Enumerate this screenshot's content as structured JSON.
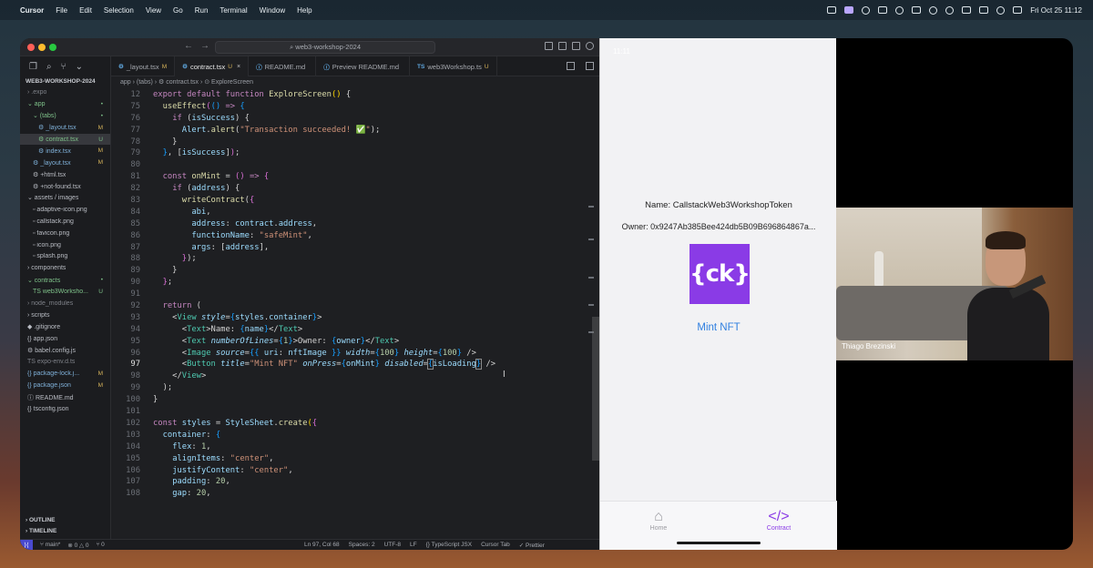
{
  "menubar": {
    "app": "Cursor",
    "items": [
      "File",
      "Edit",
      "Selection",
      "View",
      "Go",
      "Run",
      "Terminal",
      "Window",
      "Help"
    ],
    "clock": "Fri Oct 25  11:12"
  },
  "editor": {
    "search": "web3-workshop-2024",
    "explorer_title": "WEB3-WORKSHOP-2024",
    "tree": [
      {
        "name": "› .expo",
        "indent": 8,
        "status": "",
        "cls": "dim"
      },
      {
        "name": "⌄ app",
        "indent": 8,
        "status": "•",
        "cls": "green"
      },
      {
        "name": "⌄ (tabs)",
        "indent": 14,
        "status": "•",
        "cls": "green"
      },
      {
        "name": "⚙ _layout.tsx",
        "indent": 20,
        "status": "M",
        "cls": "mod"
      },
      {
        "name": "⚙ contract.tsx",
        "indent": 20,
        "status": "U",
        "cls": "green sel"
      },
      {
        "name": "⚙ index.tsx",
        "indent": 20,
        "status": "M",
        "cls": "mod"
      },
      {
        "name": "⚙ _layout.tsx",
        "indent": 14,
        "status": "M",
        "cls": "mod"
      },
      {
        "name": "⚙ +html.tsx",
        "indent": 14,
        "status": "",
        "cls": ""
      },
      {
        "name": "⚙ +not-found.tsx",
        "indent": 14,
        "status": "",
        "cls": ""
      },
      {
        "name": "⌄ assets / images",
        "indent": 8,
        "status": "",
        "cls": ""
      },
      {
        "name": "▫ adaptive-icon.png",
        "indent": 14,
        "status": "",
        "cls": ""
      },
      {
        "name": "▫ callstack.png",
        "indent": 14,
        "status": "",
        "cls": ""
      },
      {
        "name": "▫ favicon.png",
        "indent": 14,
        "status": "",
        "cls": ""
      },
      {
        "name": "▫ icon.png",
        "indent": 14,
        "status": "",
        "cls": ""
      },
      {
        "name": "▫ splash.png",
        "indent": 14,
        "status": "",
        "cls": ""
      },
      {
        "name": "› components",
        "indent": 8,
        "status": "",
        "cls": ""
      },
      {
        "name": "⌄ contracts",
        "indent": 8,
        "status": "•",
        "cls": "green"
      },
      {
        "name": "TS web3Worksho...",
        "indent": 14,
        "status": "U",
        "cls": "green"
      },
      {
        "name": "› node_modules",
        "indent": 8,
        "status": "",
        "cls": "dim"
      },
      {
        "name": "› scripts",
        "indent": 8,
        "status": "",
        "cls": ""
      },
      {
        "name": "◆ .gitignore",
        "indent": 8,
        "status": "",
        "cls": ""
      },
      {
        "name": "{} app.json",
        "indent": 8,
        "status": "",
        "cls": ""
      },
      {
        "name": "⚙ babel.config.js",
        "indent": 8,
        "status": "",
        "cls": ""
      },
      {
        "name": "TS expo-env.d.ts",
        "indent": 8,
        "status": "",
        "cls": "dim"
      },
      {
        "name": "{} package-lock.j...",
        "indent": 8,
        "status": "M",
        "cls": "mod"
      },
      {
        "name": "{} package.json",
        "indent": 8,
        "status": "M",
        "cls": "mod"
      },
      {
        "name": "ⓘ README.md",
        "indent": 8,
        "status": "",
        "cls": ""
      },
      {
        "name": "{} tsconfig.json",
        "indent": 8,
        "status": "",
        "cls": ""
      }
    ],
    "outline": "› OUTLINE",
    "timeline": "› TIMELINE",
    "tabs": [
      {
        "prefix": "⚙",
        "label": "_layout.tsx",
        "badge": "M",
        "active": false
      },
      {
        "prefix": "⚙",
        "label": "contract.tsx",
        "badge": "U",
        "active": true
      },
      {
        "prefix": "ⓘ",
        "label": "README.md",
        "badge": "",
        "active": false
      },
      {
        "prefix": "ⓘ",
        "label": "Preview README.md",
        "badge": "",
        "active": false
      },
      {
        "prefix": "TS",
        "label": "web3Workshop.ts",
        "badge": "U",
        "active": false
      }
    ],
    "breadcrumb": "app › (tabs) › ⚙ contract.tsx › ⊙ ExploreScreen",
    "lines": [
      {
        "n": "12",
        "html": "<span class='kw'>export</span> <span class='kw'>default</span> <span class='kw'>function</span> <span class='fn'>ExploreScreen</span><span class='pun'>()</span> {"
      },
      {
        "n": "75",
        "html": "  <span class='fn'>useEffect</span><span class='brk'>(</span><span class='brk2'>()</span> <span class='kw'>=></span> <span class='brk2'>{</span>"
      },
      {
        "n": "76",
        "html": "    <span class='kw'>if</span> (<span class='var'>isSuccess</span>) {"
      },
      {
        "n": "77",
        "html": "      <span class='var'>Alert</span>.<span class='fn'>alert</span>(<span class='str'>\"Transaction succeeded! ✅\"</span>);"
      },
      {
        "n": "78",
        "html": "    }"
      },
      {
        "n": "79",
        "html": "  <span class='brk2'>}</span>, [<span class='var'>isSuccess</span>]<span class='brk'>)</span>;"
      },
      {
        "n": "80",
        "html": ""
      },
      {
        "n": "81",
        "html": "  <span class='kw'>const</span> <span class='fn'>onMint</span> = <span class='brk'>()</span> <span class='kw'>=></span> <span class='brk'>{</span>"
      },
      {
        "n": "82",
        "html": "    <span class='kw'>if</span> (<span class='var'>address</span>) {"
      },
      {
        "n": "83",
        "html": "      <span class='fn'>writeContract</span>(<span class='brk'>{</span>"
      },
      {
        "n": "84",
        "html": "        <span class='var'>abi</span>,"
      },
      {
        "n": "85",
        "html": "        <span class='var'>address</span>: <span class='var'>contract</span>.<span class='var'>address</span>,"
      },
      {
        "n": "86",
        "html": "        <span class='var'>functionName</span>: <span class='str'>\"safeMint\"</span>,"
      },
      {
        "n": "87",
        "html": "        <span class='var'>args</span>: [<span class='var'>address</span>],"
      },
      {
        "n": "88",
        "html": "      <span class='brk'>}</span>);"
      },
      {
        "n": "89",
        "html": "    }"
      },
      {
        "n": "90",
        "html": "  <span class='brk'>}</span>;"
      },
      {
        "n": "91",
        "html": ""
      },
      {
        "n": "92",
        "html": "  <span class='kw'>return</span> ("
      },
      {
        "n": "93",
        "html": "    &lt;<span class='tag'>View</span> <span class='attr'>style</span>=<span class='brk2'>{</span><span class='var'>styles</span>.<span class='var'>container</span><span class='brk2'>}</span>&gt;"
      },
      {
        "n": "94",
        "html": "      &lt;<span class='tag'>Text</span>&gt;Name: <span class='brk2'>{</span><span class='var'>name</span><span class='brk2'>}</span>&lt;/<span class='tag'>Text</span>&gt;"
      },
      {
        "n": "95",
        "html": "      &lt;<span class='tag'>Text</span> <span class='attr'>numberOfLines</span>=<span class='brk2'>{</span><span class='num2'>1</span><span class='brk2'>}</span>&gt;Owner: <span class='brk2'>{</span><span class='var'>owner</span><span class='brk2'>}</span>&lt;/<span class='tag'>Text</span>&gt;"
      },
      {
        "n": "96",
        "html": "      &lt;<span class='tag'>Image</span> <span class='attr'>source</span>=<span class='brk2'>{{</span> <span class='var'>uri</span>: <span class='var'>nftImage</span> <span class='brk2'>}}</span> <span class='attr'>width</span>=<span class='brk2'>{</span><span class='num2'>100</span><span class='brk2'>}</span> <span class='attr'>height</span>=<span class='brk2'>{</span><span class='num2'>100</span><span class='brk2'>}</span> /&gt;"
      },
      {
        "n": "97",
        "html": "      &lt;<span class='tag'>Button</span> <span class='attr'>title</span>=<span class='str'>\"Mint NFT\"</span> <span class='attr'>onPress</span>=<span class='brk2'>{</span><span class='var'>onMint</span><span class='brk2'>}</span> <span class='attr'>disabled</span>=<span class='brk2 hl'>{</span><span class='var'>isLoading</span><span class='brk2 hl'>}</span> /&gt;",
        "cur": true
      },
      {
        "n": "98",
        "html": "    &lt;/<span class='tag'>View</span>&gt;"
      },
      {
        "n": "99",
        "html": "  );"
      },
      {
        "n": "100",
        "html": "}"
      },
      {
        "n": "101",
        "html": ""
      },
      {
        "n": "102",
        "html": "<span class='kw'>const</span> <span class='var'>styles</span> = <span class='var'>StyleSheet</span>.<span class='fn'>create</span><span class='pun'>(</span><span class='brk'>{</span>"
      },
      {
        "n": "103",
        "html": "  <span class='var'>container</span>: <span class='brk2'>{</span>"
      },
      {
        "n": "104",
        "html": "    <span class='var'>flex</span>: <span class='num2'>1</span>,"
      },
      {
        "n": "105",
        "html": "    <span class='var'>alignItems</span>: <span class='str'>\"center\"</span>,"
      },
      {
        "n": "106",
        "html": "    <span class='var'>justifyContent</span>: <span class='str'>\"center\"</span>,"
      },
      {
        "n": "107",
        "html": "    <span class='var'>padding</span>: <span class='num2'>20</span>,"
      },
      {
        "n": "108",
        "html": "    <span class='var'>gap</span>: <span class='num2'>20</span>,"
      }
    ],
    "status": {
      "branch": "main*",
      "problems": "⊗ 0 △ 0",
      "ports": "⑂ 0",
      "position": "Ln 97, Col 68",
      "spaces": "Spaces: 2",
      "encoding": "UTF-8",
      "eol": "LF",
      "language": "{} TypeScript JSX",
      "cursor_tab": "Cursor Tab",
      "prettier": "✓ Prettier"
    }
  },
  "phone": {
    "time": "11:11",
    "name": "Name: CallstackWeb3WorkshopToken",
    "owner": "Owner: 0x9247Ab385Bee424db5B09B696864867a...",
    "nft_logo": "{ck}",
    "mint_button": "Mint NFT",
    "tabs": [
      {
        "icon": "⌂",
        "label": "Home",
        "active": false
      },
      {
        "icon": "</>",
        "label": "Contract",
        "active": true
      }
    ]
  },
  "webcam": {
    "person_name": "Thiago Brezinski"
  },
  "colors": {
    "accent_purple": "#8a3be6",
    "link_blue": "#2f7fe0",
    "tab_active": "#8a3be6"
  }
}
